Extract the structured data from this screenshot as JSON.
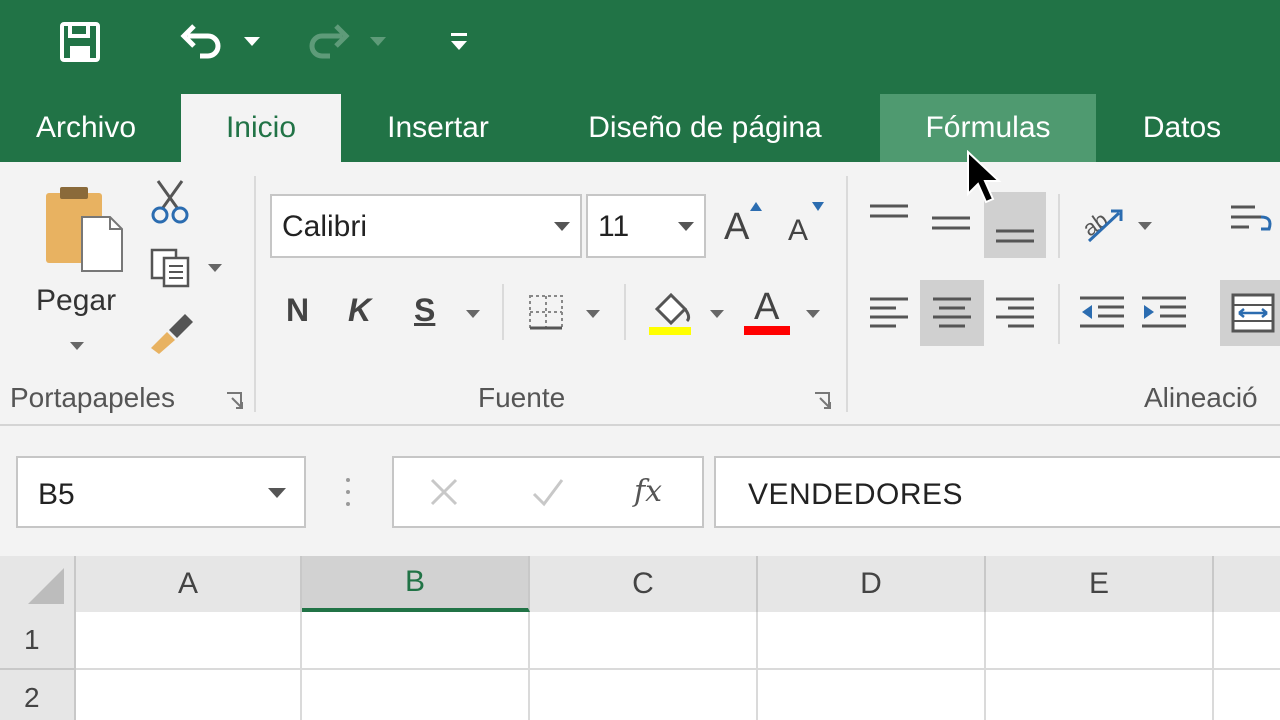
{
  "tabs": [
    {
      "id": "archivo",
      "label": "Archivo"
    },
    {
      "id": "inicio",
      "label": "Inicio"
    },
    {
      "id": "insertar",
      "label": "Insertar"
    },
    {
      "id": "diseno",
      "label": "Diseño de página"
    },
    {
      "id": "formulas",
      "label": "Fórmulas"
    },
    {
      "id": "datos",
      "label": "Datos"
    }
  ],
  "active_tab": "Inicio",
  "clipboard": {
    "paste_label": "Pegar",
    "group_label": "Portapapeles"
  },
  "font": {
    "name": "Calibri",
    "size": "11",
    "grow_label": "A",
    "shrink_label": "A",
    "bold_label": "N",
    "italic_label": "K",
    "underline_label": "S",
    "fill_label": "",
    "color_label": "A",
    "group_label": "Fuente",
    "highlight_color": "#ffff00",
    "font_color": "#ff0000"
  },
  "alignment": {
    "group_label": "Alineació"
  },
  "formula_bar": {
    "name_box": "B5",
    "fx_label": "fx",
    "content": "VENDEDORES"
  },
  "grid": {
    "columns": [
      "A",
      "B",
      "C",
      "D",
      "E"
    ],
    "selected_column": "B",
    "rows": [
      "1",
      "2"
    ]
  },
  "colors": {
    "accent": "#217346",
    "ribbon_bg": "#f3f3f3"
  }
}
